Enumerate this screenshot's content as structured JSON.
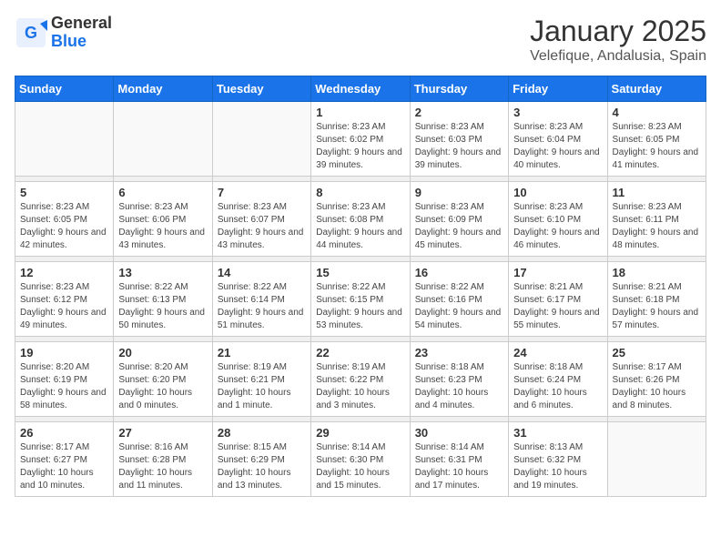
{
  "logo": {
    "general": "General",
    "blue": "Blue"
  },
  "title": "January 2025",
  "subtitle": "Velefique, Andalusia, Spain",
  "days_of_week": [
    "Sunday",
    "Monday",
    "Tuesday",
    "Wednesday",
    "Thursday",
    "Friday",
    "Saturday"
  ],
  "weeks": [
    [
      {
        "day": "",
        "info": ""
      },
      {
        "day": "",
        "info": ""
      },
      {
        "day": "",
        "info": ""
      },
      {
        "day": "1",
        "info": "Sunrise: 8:23 AM\nSunset: 6:02 PM\nDaylight: 9 hours and 39 minutes."
      },
      {
        "day": "2",
        "info": "Sunrise: 8:23 AM\nSunset: 6:03 PM\nDaylight: 9 hours and 39 minutes."
      },
      {
        "day": "3",
        "info": "Sunrise: 8:23 AM\nSunset: 6:04 PM\nDaylight: 9 hours and 40 minutes."
      },
      {
        "day": "4",
        "info": "Sunrise: 8:23 AM\nSunset: 6:05 PM\nDaylight: 9 hours and 41 minutes."
      }
    ],
    [
      {
        "day": "5",
        "info": "Sunrise: 8:23 AM\nSunset: 6:05 PM\nDaylight: 9 hours and 42 minutes."
      },
      {
        "day": "6",
        "info": "Sunrise: 8:23 AM\nSunset: 6:06 PM\nDaylight: 9 hours and 43 minutes."
      },
      {
        "day": "7",
        "info": "Sunrise: 8:23 AM\nSunset: 6:07 PM\nDaylight: 9 hours and 43 minutes."
      },
      {
        "day": "8",
        "info": "Sunrise: 8:23 AM\nSunset: 6:08 PM\nDaylight: 9 hours and 44 minutes."
      },
      {
        "day": "9",
        "info": "Sunrise: 8:23 AM\nSunset: 6:09 PM\nDaylight: 9 hours and 45 minutes."
      },
      {
        "day": "10",
        "info": "Sunrise: 8:23 AM\nSunset: 6:10 PM\nDaylight: 9 hours and 46 minutes."
      },
      {
        "day": "11",
        "info": "Sunrise: 8:23 AM\nSunset: 6:11 PM\nDaylight: 9 hours and 48 minutes."
      }
    ],
    [
      {
        "day": "12",
        "info": "Sunrise: 8:23 AM\nSunset: 6:12 PM\nDaylight: 9 hours and 49 minutes."
      },
      {
        "day": "13",
        "info": "Sunrise: 8:22 AM\nSunset: 6:13 PM\nDaylight: 9 hours and 50 minutes."
      },
      {
        "day": "14",
        "info": "Sunrise: 8:22 AM\nSunset: 6:14 PM\nDaylight: 9 hours and 51 minutes."
      },
      {
        "day": "15",
        "info": "Sunrise: 8:22 AM\nSunset: 6:15 PM\nDaylight: 9 hours and 53 minutes."
      },
      {
        "day": "16",
        "info": "Sunrise: 8:22 AM\nSunset: 6:16 PM\nDaylight: 9 hours and 54 minutes."
      },
      {
        "day": "17",
        "info": "Sunrise: 8:21 AM\nSunset: 6:17 PM\nDaylight: 9 hours and 55 minutes."
      },
      {
        "day": "18",
        "info": "Sunrise: 8:21 AM\nSunset: 6:18 PM\nDaylight: 9 hours and 57 minutes."
      }
    ],
    [
      {
        "day": "19",
        "info": "Sunrise: 8:20 AM\nSunset: 6:19 PM\nDaylight: 9 hours and 58 minutes."
      },
      {
        "day": "20",
        "info": "Sunrise: 8:20 AM\nSunset: 6:20 PM\nDaylight: 10 hours and 0 minutes."
      },
      {
        "day": "21",
        "info": "Sunrise: 8:19 AM\nSunset: 6:21 PM\nDaylight: 10 hours and 1 minute."
      },
      {
        "day": "22",
        "info": "Sunrise: 8:19 AM\nSunset: 6:22 PM\nDaylight: 10 hours and 3 minutes."
      },
      {
        "day": "23",
        "info": "Sunrise: 8:18 AM\nSunset: 6:23 PM\nDaylight: 10 hours and 4 minutes."
      },
      {
        "day": "24",
        "info": "Sunrise: 8:18 AM\nSunset: 6:24 PM\nDaylight: 10 hours and 6 minutes."
      },
      {
        "day": "25",
        "info": "Sunrise: 8:17 AM\nSunset: 6:26 PM\nDaylight: 10 hours and 8 minutes."
      }
    ],
    [
      {
        "day": "26",
        "info": "Sunrise: 8:17 AM\nSunset: 6:27 PM\nDaylight: 10 hours and 10 minutes."
      },
      {
        "day": "27",
        "info": "Sunrise: 8:16 AM\nSunset: 6:28 PM\nDaylight: 10 hours and 11 minutes."
      },
      {
        "day": "28",
        "info": "Sunrise: 8:15 AM\nSunset: 6:29 PM\nDaylight: 10 hours and 13 minutes."
      },
      {
        "day": "29",
        "info": "Sunrise: 8:14 AM\nSunset: 6:30 PM\nDaylight: 10 hours and 15 minutes."
      },
      {
        "day": "30",
        "info": "Sunrise: 8:14 AM\nSunset: 6:31 PM\nDaylight: 10 hours and 17 minutes."
      },
      {
        "day": "31",
        "info": "Sunrise: 8:13 AM\nSunset: 6:32 PM\nDaylight: 10 hours and 19 minutes."
      },
      {
        "day": "",
        "info": ""
      }
    ]
  ]
}
